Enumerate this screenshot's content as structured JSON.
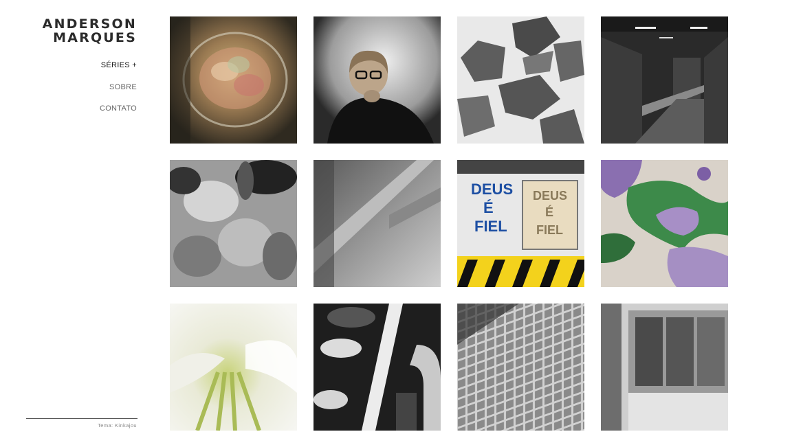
{
  "site": {
    "title_line1": "ANDERSON",
    "title_line2": "MARQUES"
  },
  "nav": {
    "items": [
      {
        "label": "SÉRIES +",
        "active": true
      },
      {
        "label": "SOBRE",
        "active": false
      },
      {
        "label": "CONTATO",
        "active": false
      }
    ]
  },
  "footer": {
    "credit": "Tema: Kinkajou"
  },
  "gallery": {
    "thumbnails": [
      {
        "subject": "flowers-in-glass"
      },
      {
        "subject": "portrait-woman-glasses"
      },
      {
        "subject": "stones-negative"
      },
      {
        "subject": "corridor"
      },
      {
        "subject": "flowers-monochrome"
      },
      {
        "subject": "light-and-shadow"
      },
      {
        "subject": "deus-e-fiel-sign",
        "text_left": [
          "DEUS",
          "É",
          "FIEL"
        ],
        "text_right": [
          "DEUS",
          "É",
          "FIEL"
        ]
      },
      {
        "subject": "green-purple-stain"
      },
      {
        "subject": "white-lily"
      },
      {
        "subject": "chair-shadows"
      },
      {
        "subject": "building-facade"
      },
      {
        "subject": "window-facade"
      }
    ]
  }
}
